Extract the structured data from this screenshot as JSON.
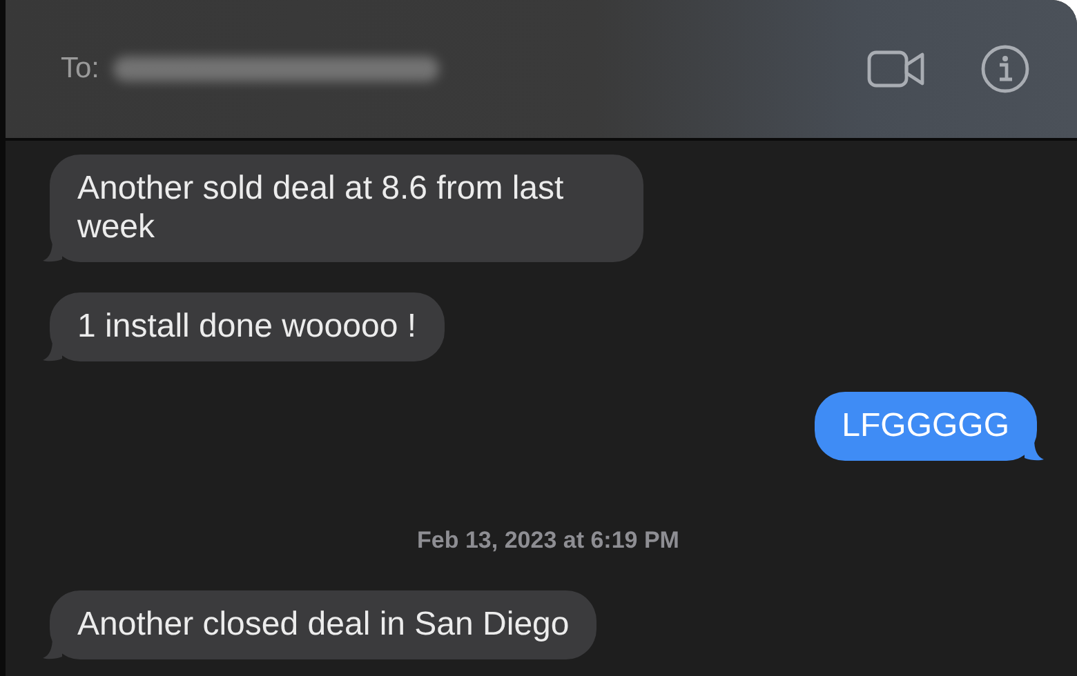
{
  "header": {
    "to_label": "To:"
  },
  "messages": [
    {
      "kind": "received",
      "text": "Another sold deal at 8.6 from last week"
    },
    {
      "kind": "received",
      "text": "1 install done wooooo !"
    },
    {
      "kind": "sent",
      "text": "LFGGGGG"
    },
    {
      "kind": "timestamp",
      "text": "Feb 13, 2023 at 6:19 PM"
    },
    {
      "kind": "received",
      "text": "Another closed deal in San Diego"
    }
  ]
}
